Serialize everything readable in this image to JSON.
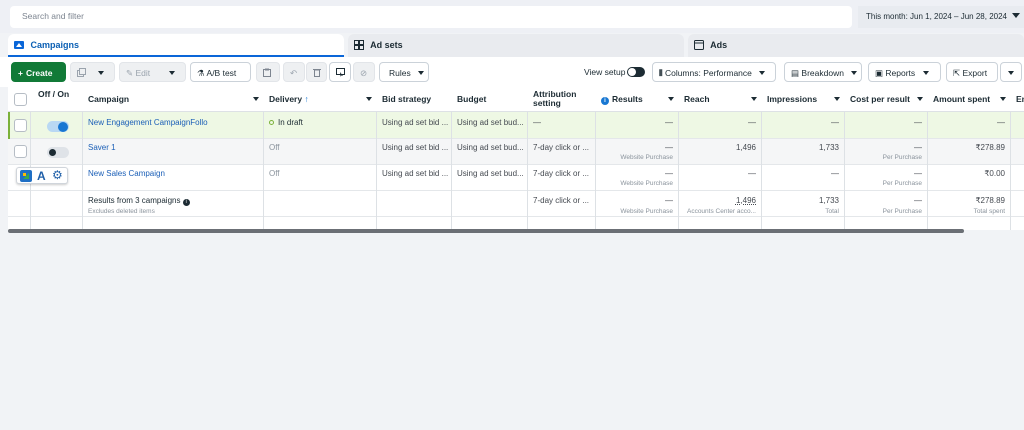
{
  "search": {
    "placeholder": "Search and filter"
  },
  "date_range": "This month: Jun 1, 2024 – Jun 28, 2024",
  "tabs": [
    {
      "label": "Campaigns",
      "icon": "folder-icon",
      "active": true
    },
    {
      "label": "Ad sets",
      "icon": "grid-icon",
      "active": false
    },
    {
      "label": "Ads",
      "icon": "ad-icon",
      "active": false
    }
  ],
  "toolbar": {
    "create": "Create",
    "edit": "Edit",
    "ab_test": "A/B test",
    "rules": "Rules",
    "view_setup": "View setup",
    "columns": "Columns: Performance",
    "breakdown": "Breakdown",
    "reports": "Reports",
    "export": "Export"
  },
  "columns": {
    "off_on": "Off / On",
    "campaign": "Campaign",
    "delivery": "Delivery",
    "delivery_sort": "↑",
    "bid_strategy": "Bid strategy",
    "budget": "Budget",
    "attribution": "Attribution setting",
    "results": "Results",
    "reach": "Reach",
    "impressions": "Impressions",
    "cost_per_result": "Cost per result",
    "amount_spent": "Amount spent",
    "ends": "En"
  },
  "rows": [
    {
      "name": "New Engagement CampaignFollo",
      "delivery": "In draft",
      "bid": "Using ad set bid ...",
      "budget": "Using ad set bud...",
      "attribution": "—",
      "results": "—",
      "results_sub": "",
      "reach": "—",
      "impressions": "—",
      "cpr": "—",
      "cpr_sub": "",
      "spent": "—",
      "on": true
    },
    {
      "name": "Saver 1",
      "delivery": "Off",
      "bid": "Using ad set bid ...",
      "budget": "Using ad set bud...",
      "attribution": "7-day click or ...",
      "results": "—",
      "results_sub": "Website Purchase",
      "reach": "1,496",
      "impressions": "1,733",
      "cpr": "—",
      "cpr_sub": "Per Purchase",
      "spent": "₹278.89",
      "on": false
    },
    {
      "name": "New Sales Campaign",
      "delivery": "Off",
      "bid": "Using ad set bid ...",
      "budget": "Using ad set bud...",
      "attribution": "7-day click or ...",
      "results": "—",
      "results_sub": "Website Purchase",
      "reach": "—",
      "impressions": "—",
      "cpr": "—",
      "cpr_sub": "Per Purchase",
      "spent": "₹0.00",
      "on": false
    }
  ],
  "summary": {
    "label": "Results from 3 campaigns",
    "sub": "Excludes deleted items",
    "attribution": "7-day click or ...",
    "results": "—",
    "results_sub": "Website Purchase",
    "reach": "1,496",
    "reach_sub": "Accounts Center acco...",
    "impressions": "1,733",
    "impressions_sub": "Total",
    "cpr": "—",
    "cpr_sub": "Per Purchase",
    "spent": "₹278.89",
    "spent_sub": "Total spent"
  },
  "floating_toolbar": {
    "letter": "A"
  }
}
